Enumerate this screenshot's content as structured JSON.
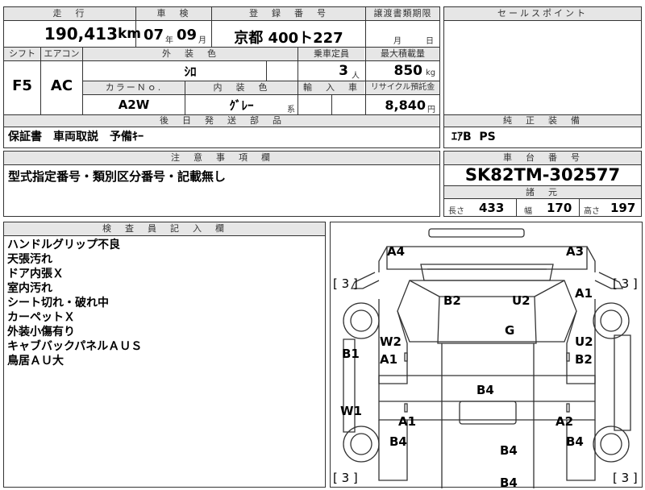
{
  "header": {
    "col_mileage": "走　行",
    "col_inspection": "車　検",
    "col_registration": "登　録　番　号",
    "col_transfer": "譲渡書類期限",
    "col_sales_point": "セールスポイント"
  },
  "row1": {
    "mileage": "190,413",
    "mileage_unit": "km",
    "insp_year": "07",
    "insp_year_unit": "年",
    "insp_month": "09",
    "insp_month_unit": "月",
    "plate": "京都 400ト227",
    "transfer_month_unit": "月",
    "transfer_day_unit": "日"
  },
  "row2_headers": {
    "shift": "シフト",
    "aircon": "エアコン",
    "exterior_color": "外　装　色",
    "capacity": "乗車定員",
    "max_load": "最大積載量",
    "color_no": "カラーＮｏ.",
    "interior_color": "内　装　色",
    "import": "輸　入　車",
    "recycle": "リサイクル預託金"
  },
  "row2": {
    "shift": "F5",
    "aircon": "AC",
    "exterior_color": "ｼﾛ",
    "capacity": "3",
    "capacity_unit": "人",
    "max_load": "850",
    "max_load_unit": "kg",
    "color_no": "A2W",
    "interior_color": "ｸﾞﾚｰ",
    "interior_suffix": "系",
    "recycle": "8,840",
    "recycle_unit": "円"
  },
  "parts": {
    "header": "後　日　発　送　部　品",
    "value": "保証書　車両取説　予備ｷｰ"
  },
  "equipment": {
    "header": "純　正　装　備",
    "value": "ｴｱB  PS"
  },
  "notes": {
    "header": "注　意　事　項　欄",
    "value": "型式指定番号・類別区分番号・記載無し"
  },
  "chassis": {
    "header": "車　台　番　号",
    "value": "SK82TM-302577",
    "dims_header": "諸　元",
    "length_label": "長さ",
    "length": "433",
    "width_label": "幅",
    "width": "170",
    "height_label": "高さ",
    "height": "197"
  },
  "inspector": {
    "header": "検　査　員　記　入　欄",
    "lines": [
      "ハンドルグリップ不良",
      "天張汚れ",
      "ドア内張Ｘ",
      "室内汚れ",
      "シート切れ・破れ中",
      "カーペットＸ",
      "外装小傷有り",
      "キャブバックパネルＡＵＳ",
      "鳥居ＡＵ大"
    ]
  },
  "diagram": {
    "marks": {
      "a4": "A4",
      "a3": "A3",
      "a1_right": "A1",
      "b2_top": "B2",
      "u2_top": "U2",
      "g": "G",
      "w2": "W2",
      "a1_inner": "A1",
      "u2_right": "U2",
      "b2_right": "B2",
      "b1": "B1",
      "b4_center": "B4",
      "w1": "W1",
      "a1_low": "A1",
      "a2": "A2",
      "b4_left": "B4",
      "b4_right": "B4",
      "b4_rear": "B4",
      "b4_bottom": "B4"
    },
    "tires": {
      "tl": "[ 3 ]",
      "tr": "[ 3 ]",
      "bl": "[ 3 ]",
      "br": "[ 3 ]"
    }
  }
}
